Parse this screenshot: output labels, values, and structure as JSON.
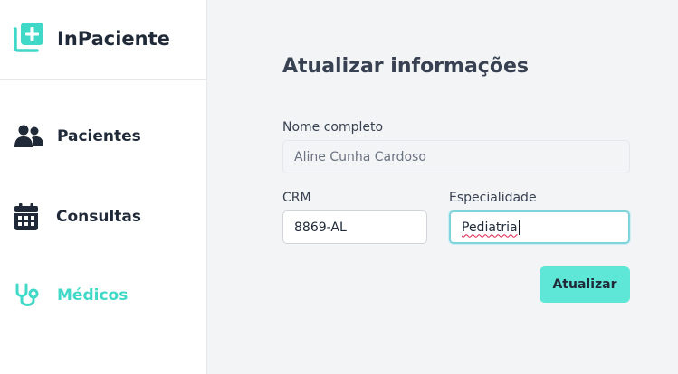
{
  "app": {
    "name": "InPaciente"
  },
  "sidebar": {
    "items": [
      {
        "label": "Pacientes",
        "icon": "users-icon",
        "active": false
      },
      {
        "label": "Consultas",
        "icon": "calendar-icon",
        "active": false
      },
      {
        "label": "Médicos",
        "icon": "stethoscope-icon",
        "active": true
      }
    ]
  },
  "form": {
    "title": "Atualizar informações",
    "nome": {
      "label": "Nome completo",
      "value": "Aline Cunha Cardoso"
    },
    "crm": {
      "label": "CRM",
      "value": "8869-AL"
    },
    "especialidade": {
      "label": "Especialidade",
      "value": "Pediatria"
    },
    "submit_label": "Atualizar"
  },
  "colors": {
    "accent": "#40d9c7",
    "button": "#5ee6d7",
    "text": "#1f2937"
  }
}
